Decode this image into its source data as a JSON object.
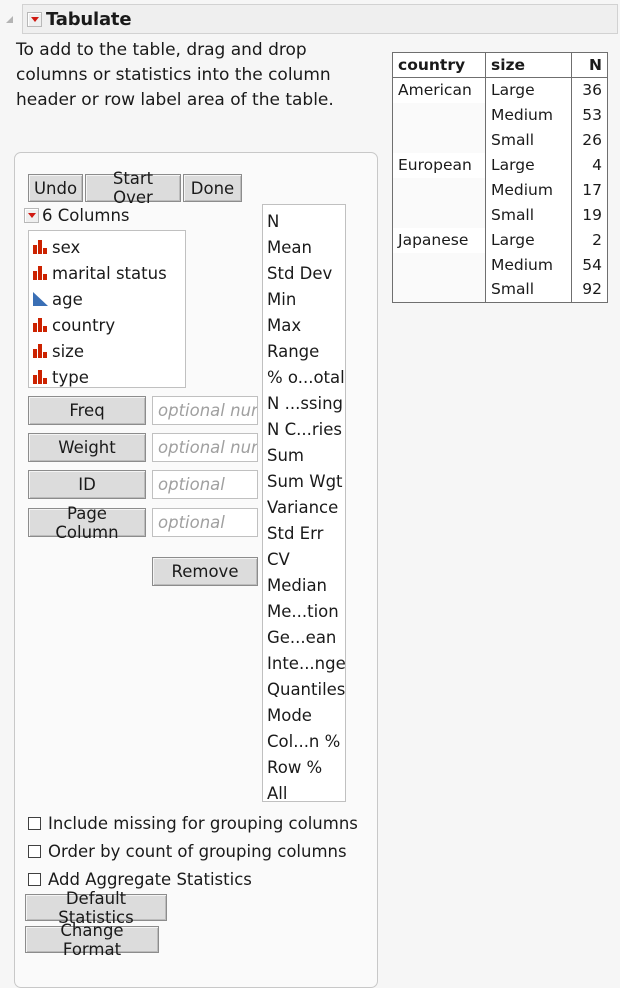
{
  "window": {
    "title": "Tabulate",
    "outline_arrow_icon": "triangle-collapsed-icon",
    "disclosure_icon": "red-disclosure-triangle-icon"
  },
  "instructions": {
    "text": "To add to the table, drag and drop columns or statistics into the column header or row label area of the table."
  },
  "result_table": {
    "headers": [
      "country",
      "size",
      "N"
    ],
    "rows": [
      {
        "country": "American",
        "size": "Large",
        "n": "36"
      },
      {
        "country": "",
        "size": "Medium",
        "n": "53"
      },
      {
        "country": "",
        "size": "Small",
        "n": "26"
      },
      {
        "country": "European",
        "size": "Large",
        "n": "4"
      },
      {
        "country": "",
        "size": "Medium",
        "n": "17"
      },
      {
        "country": "",
        "size": "Small",
        "n": "19"
      },
      {
        "country": "Japanese",
        "size": "Large",
        "n": "2"
      },
      {
        "country": "",
        "size": "Medium",
        "n": "54"
      },
      {
        "country": "",
        "size": "Small",
        "n": "92"
      }
    ]
  },
  "toolbar": {
    "undo_label": "Undo",
    "start_over_label": "Start Over",
    "done_label": "Done"
  },
  "columns_panel": {
    "header_label": "6 Columns",
    "disclosure_icon": "red-disclosure-triangle-icon",
    "items": [
      {
        "label": "sex",
        "icon": "nominal-bars-icon"
      },
      {
        "label": "marital status",
        "icon": "nominal-bars-icon"
      },
      {
        "label": "age",
        "icon": "continuous-triangle-icon"
      },
      {
        "label": "country",
        "icon": "nominal-bars-icon"
      },
      {
        "label": "size",
        "icon": "nominal-bars-icon"
      },
      {
        "label": "type",
        "icon": "nominal-bars-icon"
      }
    ]
  },
  "statistics_panel": {
    "items": [
      "N",
      "Mean",
      "Std Dev",
      "Min",
      "Max",
      "Range",
      "% o...otal",
      "N ...ssing",
      "N C...ries",
      "Sum",
      "Sum Wgt",
      "Variance",
      "Std Err",
      "CV",
      "Median",
      "Me...tion",
      "Ge...ean",
      "Inte...nge",
      "Quantiles",
      "Mode",
      "Col...n %",
      "Row %",
      "All"
    ]
  },
  "roles": {
    "freq_label": "Freq",
    "freq_placeholder": "optional numeric",
    "weight_label": "Weight",
    "weight_placeholder": "optional numeric",
    "id_label": "ID",
    "id_placeholder": "optional",
    "page_column_label": "Page Column",
    "page_column_placeholder": "optional",
    "remove_label": "Remove"
  },
  "options": {
    "include_missing_label": "Include missing for grouping columns",
    "order_by_count_label": "Order by count of grouping columns",
    "add_aggregate_label": "Add Aggregate Statistics",
    "default_statistics_label": "Default Statistics",
    "change_format_label": "Change Format"
  },
  "colors": {
    "nominal_icon": "#cc2200",
    "continuous_icon": "#3a6fb5",
    "disclosure_triangle": "#d01a12"
  }
}
